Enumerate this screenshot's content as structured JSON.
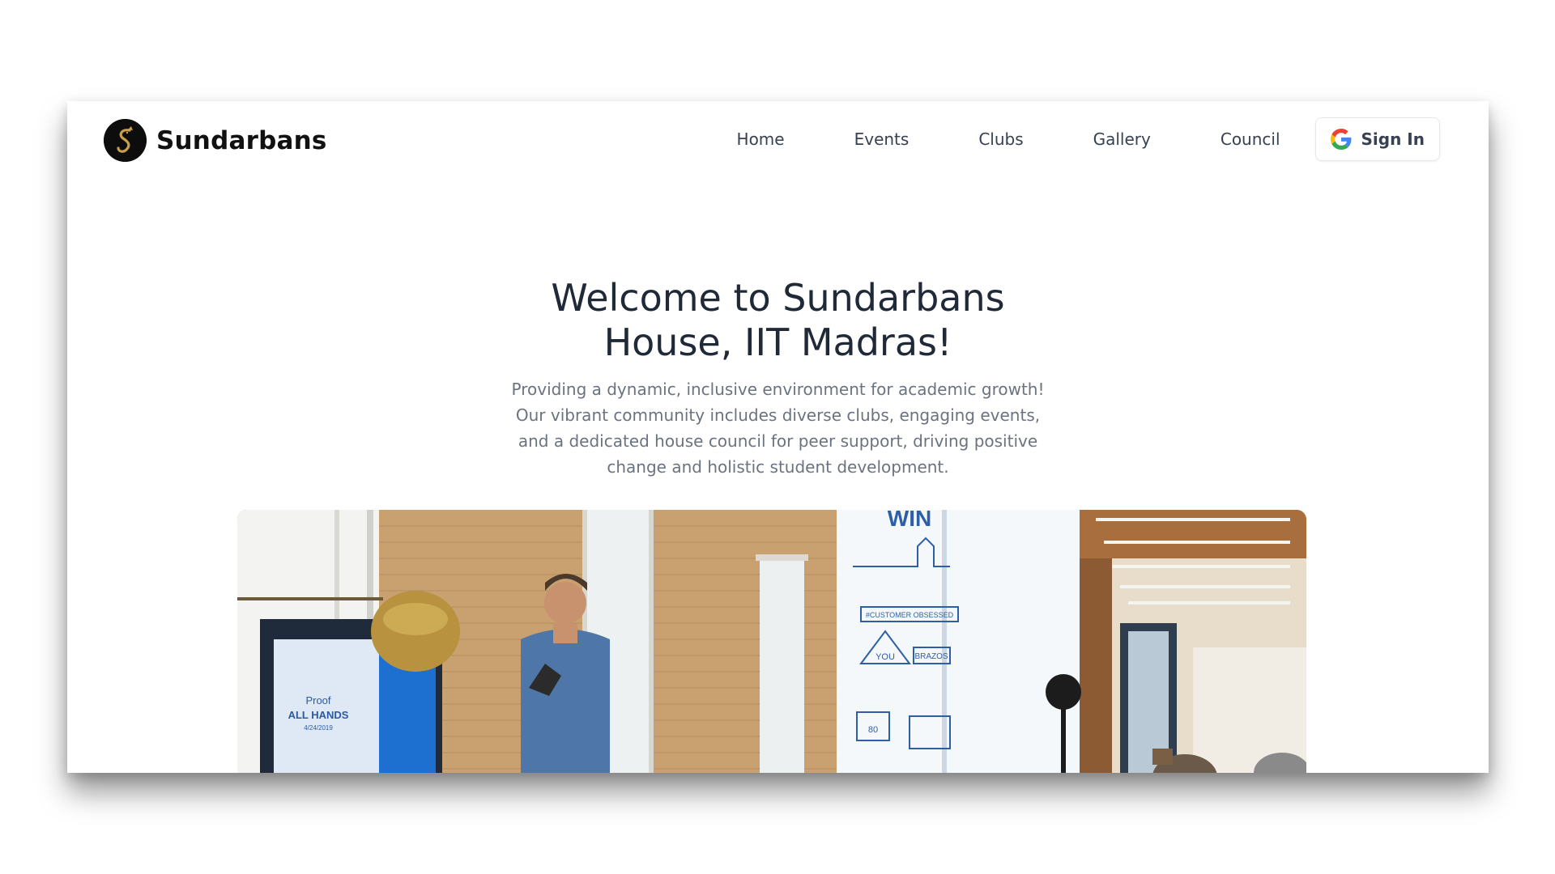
{
  "header": {
    "brand": {
      "name": "Sundarbans",
      "logo_icon": "tiger-logo-icon"
    },
    "nav": {
      "items": [
        {
          "label": "Home"
        },
        {
          "label": "Events"
        },
        {
          "label": "Clubs"
        },
        {
          "label": "Gallery"
        },
        {
          "label": "Council"
        }
      ]
    },
    "signin": {
      "label": "Sign In",
      "icon": "google-icon"
    }
  },
  "hero": {
    "title_line1": "Welcome to Sundarbans",
    "title_line2": "House, IIT Madras!",
    "description": "Providing a dynamic, inclusive environment for academic growth! Our vibrant community includes diverse clubs, engaging events, and a dedicated house council for peer support, driving positive change and holistic student development."
  },
  "photo": {
    "screen_text_line1": "Proof",
    "screen_text_line2": "ALL HANDS",
    "screen_text_line3": "4/24/2019",
    "wall_text_top": "WIN",
    "wall_banner": "#CUSTOMER OBSESSED",
    "wall_badge": "BRAZOS",
    "wall_you": "YOU",
    "wall_number": "80"
  },
  "colors": {
    "text_dark": "#1f2937",
    "text_muted": "#6b7280",
    "nav_text": "#374151",
    "google_blue": "#4285F4",
    "google_red": "#EA4335",
    "google_yellow": "#FBBC05",
    "google_green": "#34A853"
  }
}
